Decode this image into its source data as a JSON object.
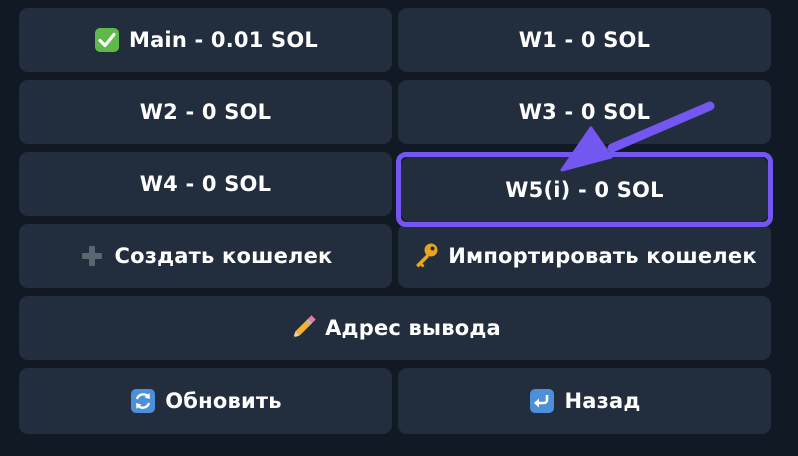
{
  "colors": {
    "background": "#111a24",
    "button": "#222e3e",
    "text": "#ffffff",
    "annotation": "#7357f0"
  },
  "buttons": {
    "main": {
      "label": "Main - 0.01 SOL",
      "icon": "check-mark-icon"
    },
    "w1": {
      "label": "W1 - 0 SOL"
    },
    "w2": {
      "label": "W2 - 0 SOL"
    },
    "w3": {
      "label": "W3 - 0 SOL"
    },
    "w4": {
      "label": "W4 - 0 SOL"
    },
    "w5": {
      "label": "W5(i) - 0 SOL"
    },
    "create_wallet": {
      "label": "Создать кошелек",
      "icon": "plus-icon"
    },
    "import_wallet": {
      "label": "Импортировать кошелек",
      "icon": "key-icon"
    },
    "withdraw_address": {
      "label": "Адрес вывода",
      "icon": "pencil-icon"
    },
    "refresh": {
      "label": "Обновить",
      "icon": "refresh-icon"
    },
    "back": {
      "label": "Назад",
      "icon": "return-arrow-icon"
    }
  }
}
